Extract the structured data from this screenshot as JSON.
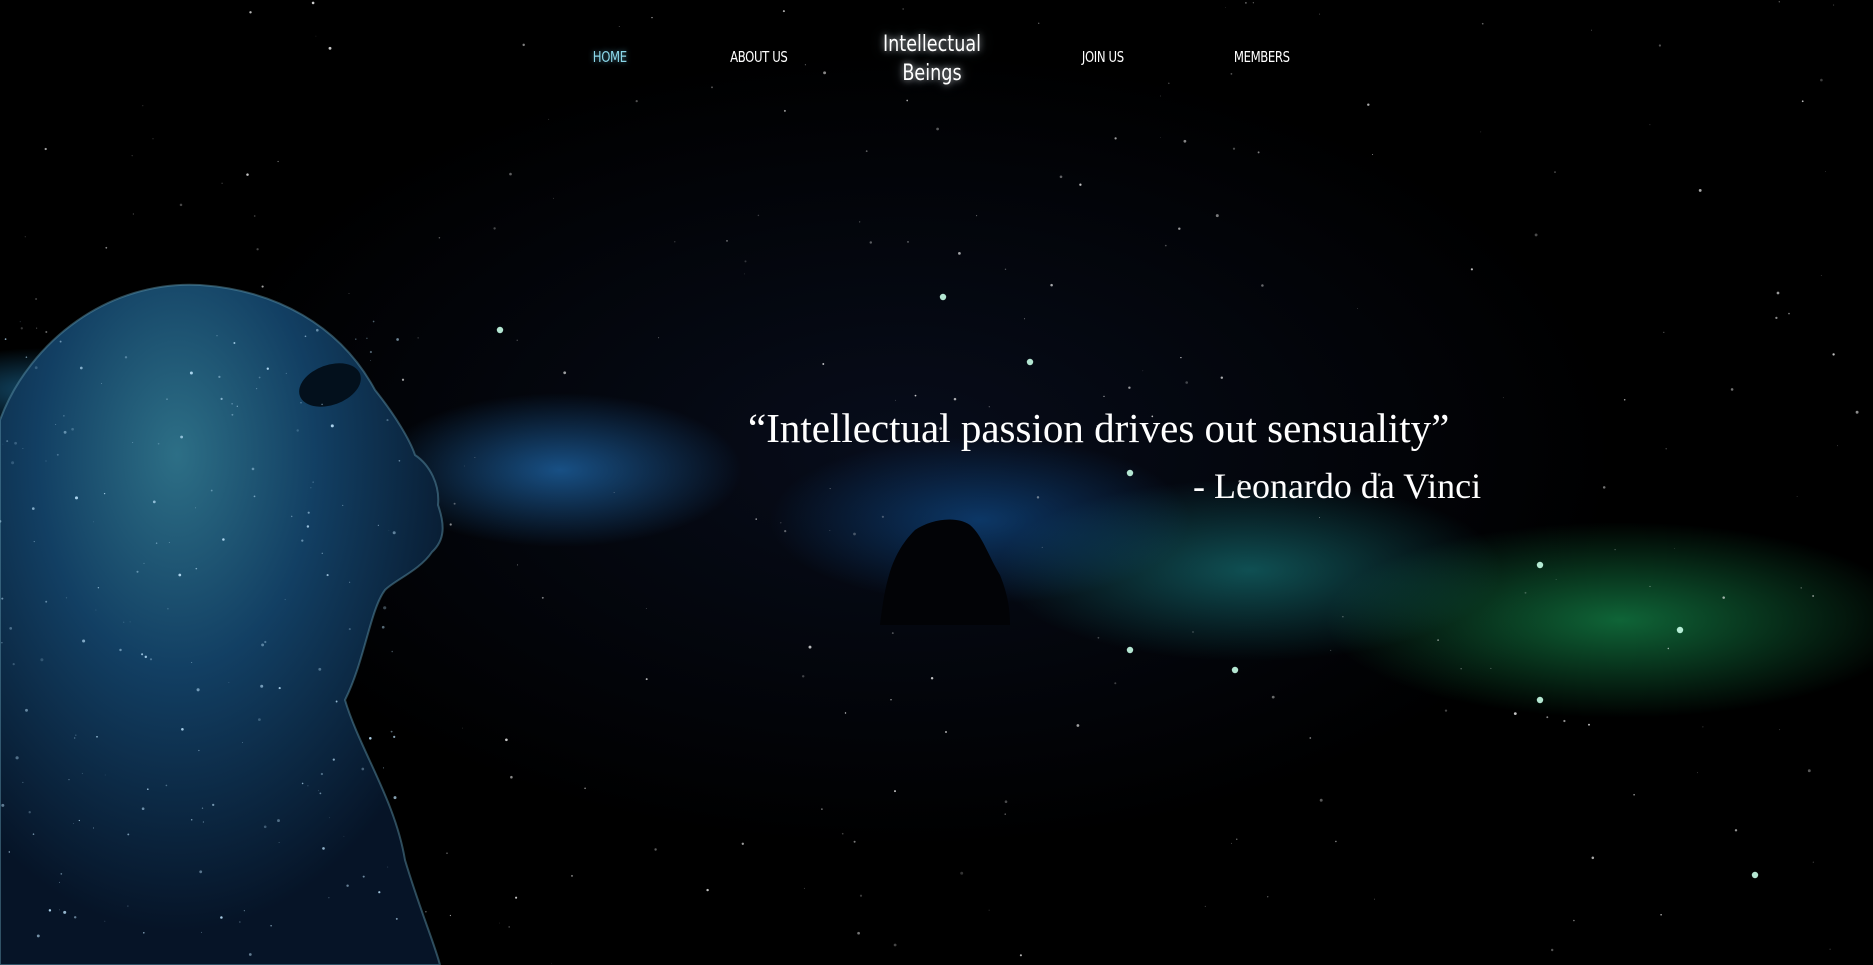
{
  "nav": {
    "home": "HOME",
    "about": "ABOUT US",
    "brand_line1": "Intellectual",
    "brand_line2": "Beings",
    "join": "JOIN US",
    "members": "MEMBERS"
  },
  "hero": {
    "quote": "“Intellectual passion drives out sensuality”",
    "author": "- Leonardo da Vinci"
  },
  "colors": {
    "active_nav": "#8ad6e8",
    "text": "#ffffff",
    "background": "#000000"
  }
}
